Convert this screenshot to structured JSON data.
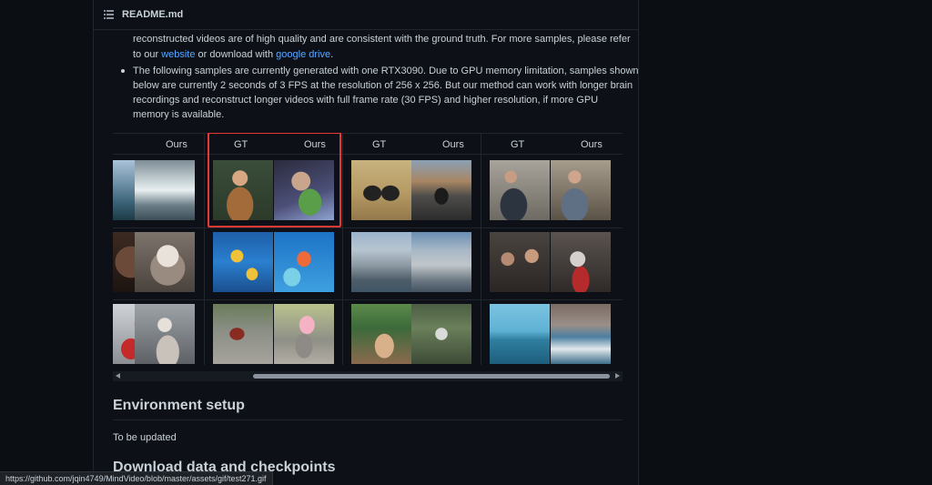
{
  "readme": {
    "title": "README.md",
    "list_icon": "list-icon"
  },
  "intro": {
    "line1": "reconstructed videos are of high quality and are consistent with the ground truth. For more samples, please refer",
    "line2_pre": "to our ",
    "line2_link1": "website",
    "line2_mid": " or download with ",
    "line2_link2": "google drive",
    "line2_post": "."
  },
  "bullet": {
    "line1": "The following samples are currently generated with one RTX3090. Due to GPU memory limitation, samples shown",
    "line2": "below are currently 2 seconds of 3 FPS at the resolution of 256 x 256. But our method can work with longer brain",
    "line3": "recordings and reconstruct longer videos with full frame rate (30 FPS) and higher resolution, if more GPU",
    "line4": "memory is available."
  },
  "gallery": {
    "headers": [
      "Ours",
      "GT",
      "Ours",
      "GT",
      "Ours",
      "GT",
      "Ours"
    ],
    "highlight_color": "#e53935"
  },
  "environment": {
    "heading": "Environment setup",
    "text": "To be updated"
  },
  "download": {
    "heading": "Download data and checkpoints"
  },
  "status_url": "https://github.com/jqin4749/MindVideo/blob/master/assets/gif/test271.gif"
}
